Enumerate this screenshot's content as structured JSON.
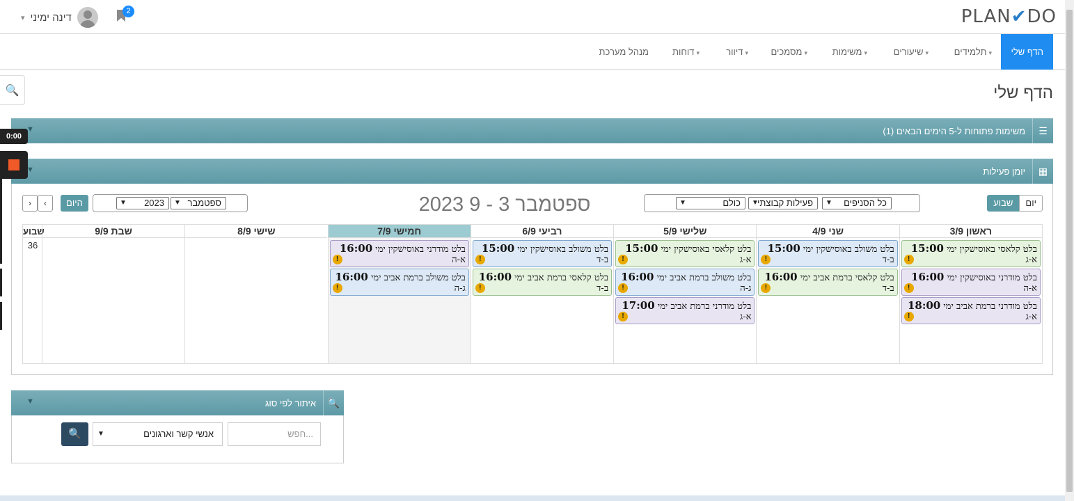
{
  "header": {
    "logo_text": "PLAN",
    "logo_check": "✔",
    "logo_end": "DO",
    "user_name": "דינה ימיני",
    "notifications": "2"
  },
  "nav": [
    {
      "label": "הדף שלי",
      "active": true
    },
    {
      "label": "תלמידים"
    },
    {
      "label": "שיעורים"
    },
    {
      "label": "משימות"
    },
    {
      "label": "מסמכים"
    },
    {
      "label": "דיוור"
    },
    {
      "label": "דוחות"
    },
    {
      "label": "מנהל מערכת"
    }
  ],
  "page_title": "הדף שלי",
  "recorder": {
    "time": "0:00"
  },
  "panels": {
    "tasks_title": "משימות פתוחות ל-5 הימים הבאים (1)",
    "calendar_title": "יומן פעילות",
    "search_title": "איתור לפי סוג"
  },
  "calendar": {
    "view_day": "יום",
    "view_week": "שבוע",
    "filter_branches": "כל הסניפים",
    "filter_activity": "פעילות קבוצתי",
    "filter_who": "כולם",
    "title": "ספטמבר 3 - 9 2023",
    "month": "ספטמבר",
    "year": "2023",
    "today_btn": "היום",
    "prev": "‹",
    "next": "›",
    "week_label": "שבוע",
    "week_number": "36",
    "days": [
      {
        "label": "ראשון 3/9",
        "events": [
          {
            "time": "15:00",
            "title": "בלט קלאסי באוסישקין ימי",
            "group": "א-ג",
            "color": "green"
          },
          {
            "time": "16:00",
            "title": "בלט מודרני באוסישקין ימי",
            "group": "א-ה",
            "color": "purple"
          },
          {
            "time": "18:00",
            "title": "בלט מודרני ברמת אביב ימי",
            "group": "א-ג",
            "color": "purple"
          }
        ]
      },
      {
        "label": "שני 4/9",
        "events": [
          {
            "time": "15:00",
            "title": "בלט משולב באוסישקין ימי",
            "group": "ב-ד",
            "color": "blue"
          },
          {
            "time": "16:00",
            "title": "בלט קלאסי ברמת אביב ימי",
            "group": "ב-ד",
            "color": "green"
          }
        ]
      },
      {
        "label": "שלישי 5/9",
        "events": [
          {
            "time": "15:00",
            "title": "בלט קלאסי באוסישקין ימי",
            "group": "א-ג",
            "color": "green"
          },
          {
            "time": "16:00",
            "title": "בלט משולב ברמת אביב ימי",
            "group": "ג-ה",
            "color": "blue"
          },
          {
            "time": "17:00",
            "title": "בלט מודרני ברמת אביב ימי",
            "group": "א-ג",
            "color": "purple"
          }
        ]
      },
      {
        "label": "רביעי 6/9",
        "events": [
          {
            "time": "15:00",
            "title": "בלט משולב באוסישקין ימי",
            "group": "ב-ד",
            "color": "blue"
          },
          {
            "time": "16:00",
            "title": "בלט קלאסי ברמת אביב ימי",
            "group": "ב-ד",
            "color": "green"
          }
        ]
      },
      {
        "label": "חמישי 7/9",
        "today": true,
        "events": [
          {
            "time": "16:00",
            "title": "בלט מודרני באוסישקין ימי",
            "group": "א-ה",
            "color": "purple"
          },
          {
            "time": "16:00",
            "title": "בלט משולב ברמת אביב ימי",
            "group": "ג-ה",
            "color": "blue"
          }
        ]
      },
      {
        "label": "שישי 8/9",
        "events": []
      },
      {
        "label": "שבת 9/9",
        "events": []
      }
    ]
  },
  "search": {
    "placeholder": "חפש...",
    "type": "אנשי קשר וארגונים"
  }
}
